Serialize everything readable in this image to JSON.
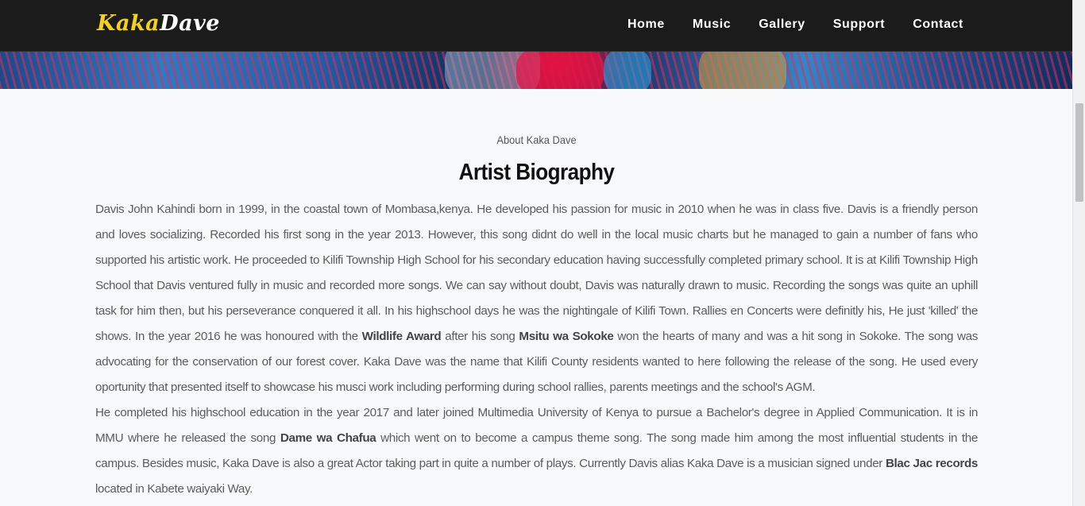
{
  "brand": {
    "part1": "Kaka",
    "part2": "Dave"
  },
  "nav": {
    "items": [
      "Home",
      "Music",
      "Gallery",
      "Support",
      "Contact"
    ]
  },
  "about": {
    "eyebrow": "About Kaka Dave",
    "title": "Artist Biography"
  },
  "bio": {
    "p1_a": "Davis John Kahindi born in 1999, in the coastal town of Mombasa,kenya. He developed his passion for music in 2010 when he was in class five. Davis is a friendly person and loves socializing. Recorded his first song in the year 2013. However, this song didnt do well in the local music charts but he managed to gain a number of fans who supported his artistic work. He proceeded to Kilifi Township High School for his secondary education having successfully completed primary school. It is at Kilifi Township High School that Davis ventured fully in music and recorded more songs. We can say without doubt, Davis was naturally drawn to music. Recording the songs was quite an uphill task for him then, but his perseverance conquered it all. In his highschool days he was the nightingale of Kilifi Town. Rallies en Concerts were definitly his, He just 'killed' the shows. In the year 2016 he was honoured with the ",
    "p1_award": "Wildlife Award",
    "p1_b": " after his song ",
    "p1_song": "Msitu wa Sokoke",
    "p1_c": " won the hearts of many and was a hit song in Sokoke. The song was advocating for the conservation of our forest cover. Kaka Dave was the name that Kilifi County residents wanted to here following the release of the song. He used every oportunity that presented itself to showcase his musci work including performing during school rallies, parents meetings and the school's AGM.",
    "p2_a": "He completed his highschool education in the year 2017 and later joined Multimedia University of Kenya to pursue a Bachelor's degree in Applied Communication. It is in MMU where he released the song ",
    "p2_song": "Dame wa Chafua",
    "p2_b": " which went on to become a campus theme song. The song made him among the most influential students in the campus. Besides music, Kaka Dave is also a great Actor taking part in quite a number of plays. Currently Davis alias Kaka Dave is a musician signed under ",
    "p2_label": "Blac Jac records",
    "p2_c": " located in Kabete waiyaki Way."
  },
  "colors": {
    "navbar_bg": "#1b1b1b",
    "brand_accent": "#f3d21e",
    "page_bg": "#f8f9fb"
  }
}
